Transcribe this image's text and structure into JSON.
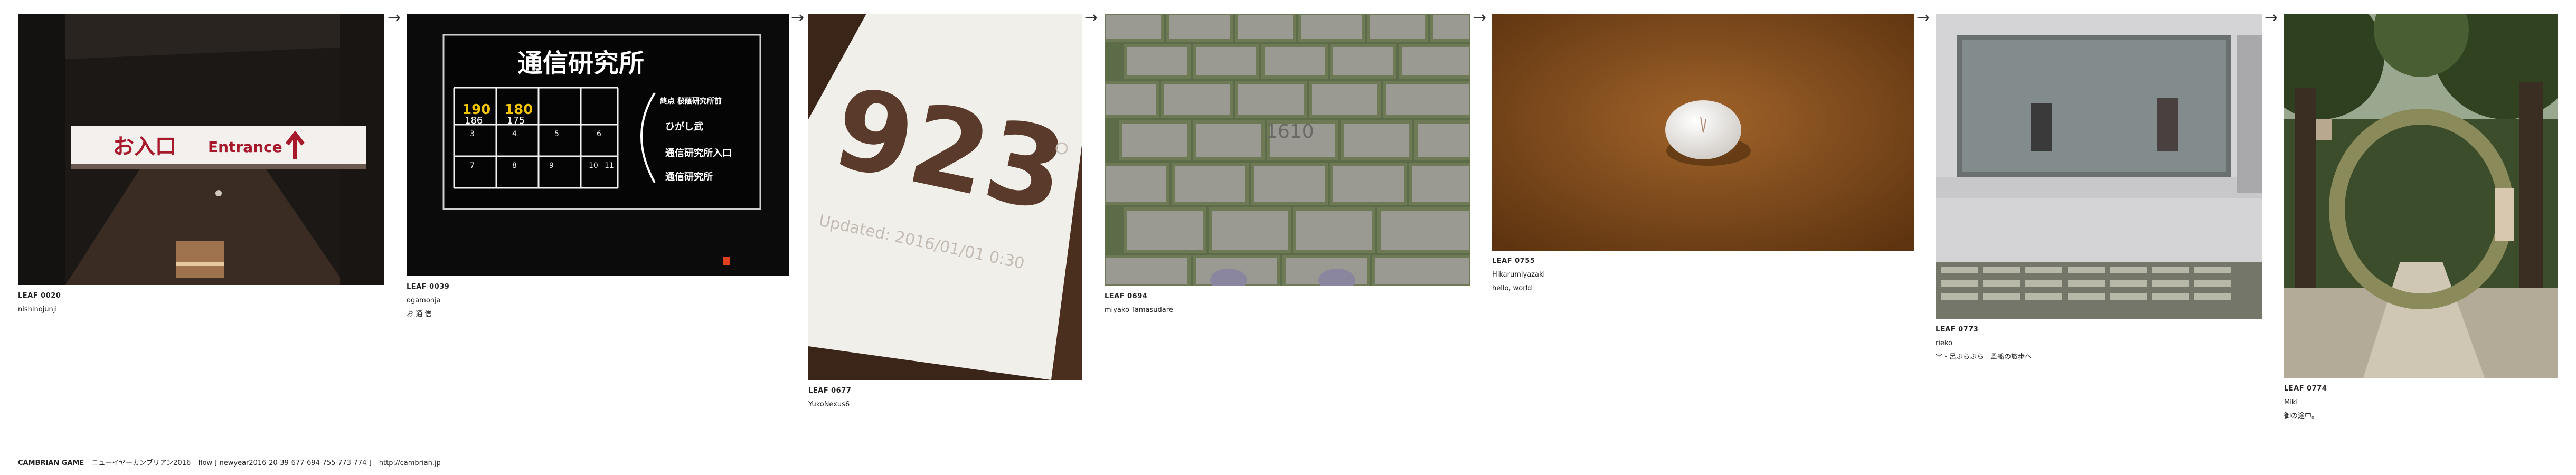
{
  "leaves": [
    {
      "id": "LEAF 0020",
      "author": "nishinojunji",
      "message": "",
      "sign_text": "お入口",
      "sign_en": "Entrance"
    },
    {
      "id": "LEAF 0039",
      "author": "ogamonja",
      "message": "お 通 信",
      "board_title": "通信研究所",
      "board_stations": [
        "終点 桜蔭研究所前",
        "ひがし武",
        "通信研究所入口",
        "通信研究所"
      ],
      "board_times": [
        "190",
        "180",
        "186",
        "175"
      ],
      "board_nums": [
        "3",
        "4",
        "5",
        "6",
        "7",
        "8",
        "9",
        "10",
        "11"
      ]
    },
    {
      "id": "LEAF 0677",
      "author": "YukoNexus6",
      "message": "",
      "big_number": "923",
      "updated": "Updated: 2016/01/01 0:30"
    },
    {
      "id": "LEAF 0694",
      "author": "miyako Tamasudare",
      "message": "",
      "stone_number": "1610"
    },
    {
      "id": "LEAF 0755",
      "author": "Hikarumiyazaki",
      "message": "hello, world"
    },
    {
      "id": "LEAF 0773",
      "author": "rieko",
      "message": "字・呂ぶらぶら　風船の旅歩へ"
    },
    {
      "id": "LEAF 0774",
      "author": "Miki",
      "message": "御の途中。"
    }
  ],
  "arrow_glyph": "→",
  "footer": {
    "title": "CAMBRIAN GAME",
    "subtitle": "ニューイヤーカンブリアン2016",
    "flow": "flow [ newyear2016-20-39-677-694-755-773-774 ]",
    "url": "http://cambrian.jp"
  }
}
